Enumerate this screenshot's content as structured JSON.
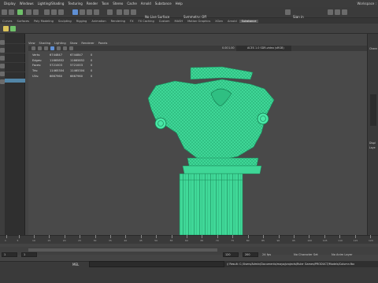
{
  "menu": {
    "items": [
      "Display",
      "Windows",
      "Lighting/Shading",
      "Texturing",
      "Render",
      "Toon",
      "Stereo",
      "Cache",
      "Arnold",
      "Substance",
      "Help"
    ],
    "workspace": "Workspace :"
  },
  "status": {
    "live_surface": "No Live Surface",
    "symmetry": "Symmetry: Off",
    "sign_in": "Sign in"
  },
  "shelf_tabs": {
    "items": [
      "Curves",
      "Surfaces",
      "Poly Modeling",
      "Sculpting",
      "Rigging",
      "Animation",
      "Rendering",
      "FX",
      "FX Caching",
      "Custom",
      "MASH",
      "Motion Graphics",
      "XGen",
      "Arnold",
      "Substance"
    ],
    "active": "Substance"
  },
  "panel_menu": {
    "items": [
      "View",
      "Shading",
      "Lighting",
      "Show",
      "Renderer",
      "Panels"
    ]
  },
  "camera": {
    "gamma": "1.00",
    "exposure": "0.00",
    "color_space": "ACES 1.0 SDR-video (sRGB)"
  },
  "hud": {
    "rows": [
      {
        "label": "Verts:",
        "a": "6744847",
        "b": "6744847",
        "c": "0"
      },
      {
        "label": "Edges:",
        "a": "11665852",
        "b": "11665852",
        "c": "0"
      },
      {
        "label": "Faces:",
        "a": "5721003",
        "b": "5721003",
        "c": "0"
      },
      {
        "label": "Tris:",
        "a": "11465304",
        "b": "11465304",
        "c": "0"
      },
      {
        "label": "UVs:",
        "a": "6667960",
        "b": "6667960",
        "c": "0"
      }
    ]
  },
  "dock": {
    "channel_tab": "Chann",
    "display_tab": "Displ",
    "layers_tab": "Laye"
  },
  "time": {
    "ticks": [
      1,
      5,
      10,
      15,
      20,
      25,
      30,
      35,
      40,
      45,
      50,
      55,
      60,
      65,
      70,
      75,
      80,
      85,
      90,
      95,
      100,
      105,
      110,
      115,
      120
    ],
    "start_field": "1",
    "current_field": "1",
    "range_start": "1",
    "range_end": "120",
    "range_end2": "120",
    "anim_end": "200",
    "fps": "24 fps",
    "character_set": "No Character Set",
    "anim_layer": "No Anim Layer"
  },
  "command": {
    "label": "MEL",
    "result": "// Result: C:/Users/Admin/Documents/maya/projects/Ruler Games/PRODUCT/Models/Column.fbx"
  },
  "colors": {
    "wire": "#49e7a6",
    "wire_shade": "#1fa872",
    "accent_select": "#5285a6"
  }
}
